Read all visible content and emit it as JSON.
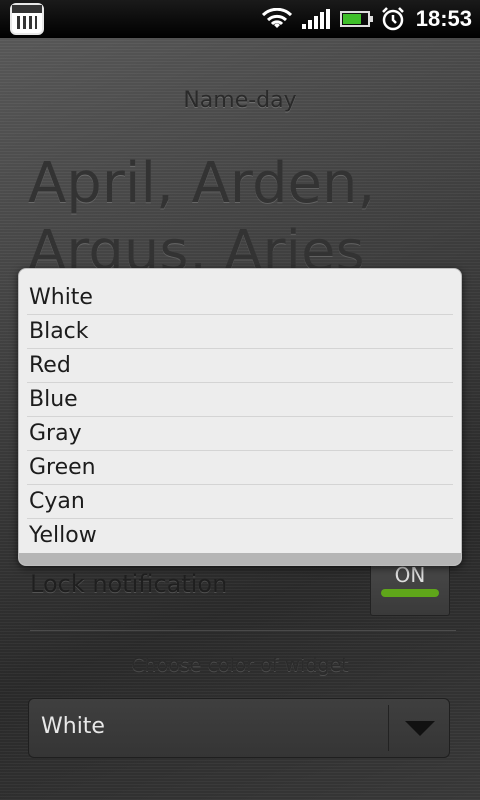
{
  "status_bar": {
    "time": "18:53",
    "icons": [
      "calendar-icon",
      "wifi-icon",
      "signal-icon",
      "battery-icon",
      "alarm-icon"
    ]
  },
  "widget": {
    "nameday_label": "Name-day",
    "names_line1": "April, Arden,",
    "names_line2": "Argus, Aries"
  },
  "settings": {
    "lock_notification_label": "Lock notification",
    "lock_toggle_text": "ON",
    "choose_color_label": "Choose color of widget",
    "color_selected": "White"
  },
  "popup": {
    "options": [
      "White",
      "Black",
      "Red",
      "Blue",
      "Gray",
      "Green",
      "Cyan",
      "Yellow"
    ]
  },
  "colors": {
    "toggle_on": "#5fa61a",
    "battery_fill": "#3fbf2a"
  }
}
